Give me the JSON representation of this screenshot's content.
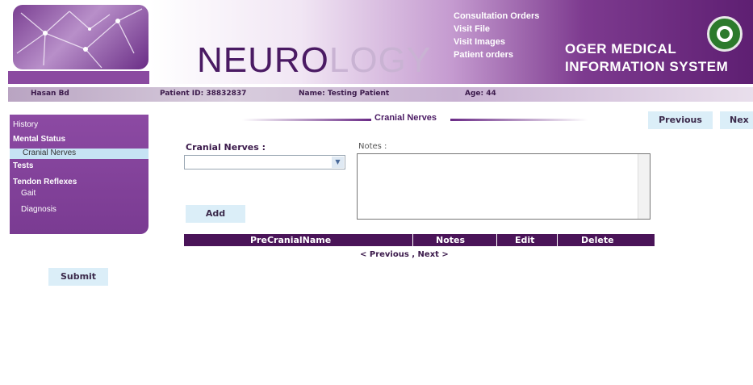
{
  "header": {
    "title_dark": "NEURO",
    "title_light": "LOGY",
    "links": [
      "Consultation Orders",
      "Visit File",
      "Visit Images",
      "Patient orders"
    ],
    "brand_line1": "OGER MEDICAL",
    "brand_line2": "INFORMATION SYSTEM"
  },
  "infobar": {
    "user": "Hasan Bd",
    "patient_id": "Patient ID: 38832837",
    "name": "Name: Testing Patient",
    "age": "Age: 44"
  },
  "sidebar": {
    "items": [
      {
        "label": "History"
      },
      {
        "label": "Mental Status"
      },
      {
        "label": "Cranial Nerves"
      },
      {
        "label": "Tests"
      },
      {
        "label": "Tendon Reflexes"
      },
      {
        "label": "Gait"
      },
      {
        "label": "Diagnosis"
      }
    ],
    "submit_label": "Submit"
  },
  "main": {
    "section_title": "Cranial Nerves",
    "previous_label": "Previous",
    "next_label": "Nex",
    "cranial_label": "Cranial Nerves :",
    "cranial_value": "",
    "notes_label": "Notes :",
    "add_label": "Add",
    "table_headers": [
      "PreCranialName",
      "Notes",
      "Edit",
      "Delete"
    ],
    "pager": "< Previous , Next >"
  },
  "colors": {
    "purple_dark": "#4a1458",
    "purple": "#8c4aa3",
    "button_bg": "#dbeef8"
  }
}
